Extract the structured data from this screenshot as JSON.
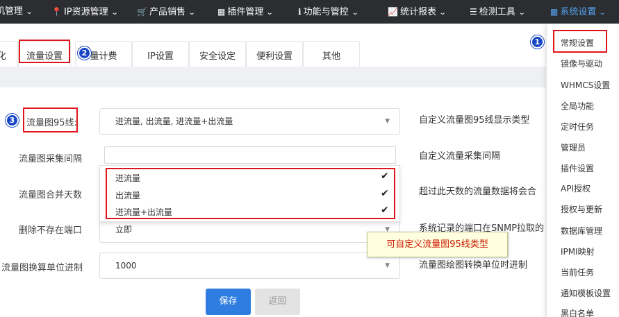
{
  "nav": {
    "items": [
      {
        "icon": "",
        "label": "机管理"
      },
      {
        "icon": "📍",
        "label": "IP资源管理"
      },
      {
        "icon": "🛒",
        "label": "产品销售"
      },
      {
        "icon": "▦",
        "label": "插件管理"
      },
      {
        "icon": "ℹ",
        "label": "功能与管控"
      },
      {
        "icon": "📈",
        "label": "统计报表"
      },
      {
        "icon": "☰",
        "label": "检测工具"
      },
      {
        "icon": "▦",
        "label": "系统设置"
      }
    ],
    "chevron": "⌄"
  },
  "tabs": [
    {
      "label": "化"
    },
    {
      "label": "流量设置"
    },
    {
      "label": "量计费"
    },
    {
      "label": "IP设置"
    },
    {
      "label": "安全设定"
    },
    {
      "label": "便利设置"
    },
    {
      "label": "其他"
    }
  ],
  "form": {
    "rows": [
      {
        "label": "流量图95线:",
        "value": "进流量, 出流量, 进流量+出流量",
        "desc": "自定义流量图95线显示类型"
      },
      {
        "label": "流量图采集间隔",
        "value": "",
        "desc": "自定义流量采集间隔"
      },
      {
        "label": "流量图合并天数",
        "value": "",
        "desc": "超过此天数的流量数据将会合"
      },
      {
        "label": "删除不存在端口",
        "value": "立即",
        "desc": "系统记录的端口在SNMP拉取的"
      },
      {
        "label": "流量图换算单位进制",
        "value": "1000",
        "desc": "流量图绘图转换单位时进制"
      }
    ],
    "caret": "▼"
  },
  "dropdown": {
    "options": [
      "进流量",
      "出流量",
      "进流量+出流量"
    ],
    "check": "✔"
  },
  "buttons": {
    "save": "保存",
    "back": "返回"
  },
  "tooltip": "可自定义流量图95线类型",
  "menu": {
    "items": [
      "常规设置",
      "镜像与驱动",
      "WHMCS设置",
      "全局功能",
      "定时任务",
      "管理员",
      "插件设置",
      "API授权",
      "授权与更新",
      "数据库管理",
      "IPMI映射",
      "当前任务",
      "通知模板设置",
      "黑白名单"
    ]
  },
  "badges": [
    "1",
    "2",
    "3"
  ],
  "colors": {
    "nav_bg": "#2b2d30",
    "nav_active": "#57a3f3",
    "primary": "#2f7de1",
    "annotation_red": "#e0141b",
    "badge_blue": "#1645c7",
    "tooltip_text": "#cc1a00"
  }
}
